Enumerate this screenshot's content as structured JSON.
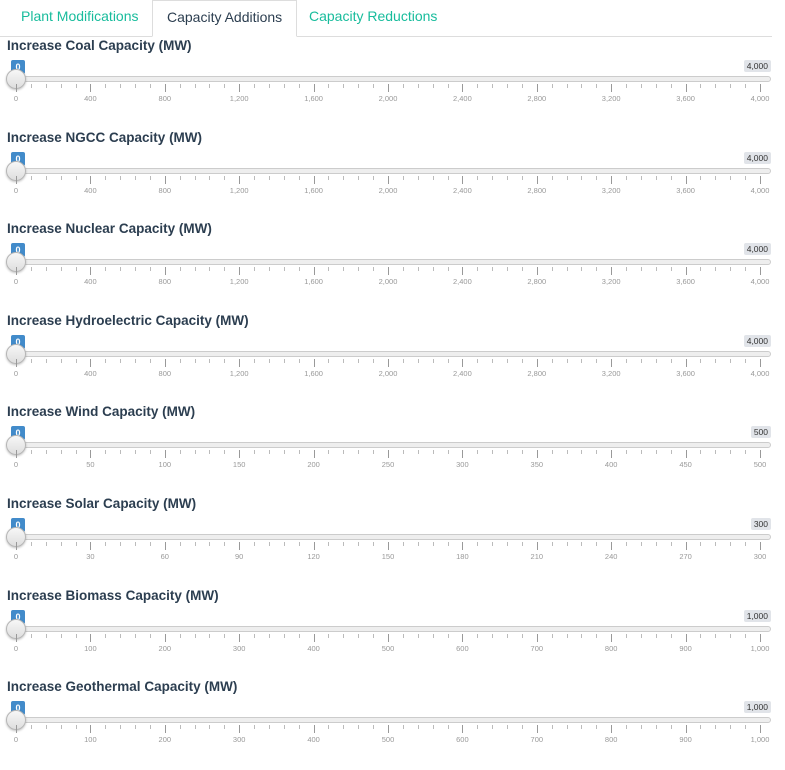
{
  "tabs": [
    {
      "label": "Plant Modifications",
      "active": false
    },
    {
      "label": "Capacity Additions",
      "active": true
    },
    {
      "label": "Capacity Reductions",
      "active": false
    }
  ],
  "colors": {
    "tab_link": "#18bc9c",
    "tab_active": "#2c3e50",
    "min_badge": "#428bca",
    "max_badge": "#e1e4e9"
  },
  "sliders": [
    {
      "label": "Increase Coal Capacity (MW)",
      "value": "0",
      "max_display": "4,000",
      "min": 0,
      "max": 4000,
      "ticks": [
        "0",
        "400",
        "800",
        "1,200",
        "1,600",
        "2,000",
        "2,400",
        "2,800",
        "3,200",
        "3,600",
        "4,000"
      ]
    },
    {
      "label": "Increase NGCC Capacity (MW)",
      "value": "0",
      "max_display": "4,000",
      "min": 0,
      "max": 4000,
      "ticks": [
        "0",
        "400",
        "800",
        "1,200",
        "1,600",
        "2,000",
        "2,400",
        "2,800",
        "3,200",
        "3,600",
        "4,000"
      ]
    },
    {
      "label": "Increase Nuclear Capacity (MW)",
      "value": "0",
      "max_display": "4,000",
      "min": 0,
      "max": 4000,
      "ticks": [
        "0",
        "400",
        "800",
        "1,200",
        "1,600",
        "2,000",
        "2,400",
        "2,800",
        "3,200",
        "3,600",
        "4,000"
      ]
    },
    {
      "label": "Increase Hydroelectric Capacity (MW)",
      "value": "0",
      "max_display": "4,000",
      "min": 0,
      "max": 4000,
      "ticks": [
        "0",
        "400",
        "800",
        "1,200",
        "1,600",
        "2,000",
        "2,400",
        "2,800",
        "3,200",
        "3,600",
        "4,000"
      ]
    },
    {
      "label": "Increase Wind Capacity (MW)",
      "value": "0",
      "max_display": "500",
      "min": 0,
      "max": 500,
      "ticks": [
        "0",
        "50",
        "100",
        "150",
        "200",
        "250",
        "300",
        "350",
        "400",
        "450",
        "500"
      ]
    },
    {
      "label": "Increase Solar Capacity (MW)",
      "value": "0",
      "max_display": "300",
      "min": 0,
      "max": 300,
      "ticks": [
        "0",
        "30",
        "60",
        "90",
        "120",
        "150",
        "180",
        "210",
        "240",
        "270",
        "300"
      ]
    },
    {
      "label": "Increase Biomass Capacity (MW)",
      "value": "0",
      "max_display": "1,000",
      "min": 0,
      "max": 1000,
      "ticks": [
        "0",
        "100",
        "200",
        "300",
        "400",
        "500",
        "600",
        "700",
        "800",
        "900",
        "1,000"
      ]
    },
    {
      "label": "Increase Geothermal Capacity (MW)",
      "value": "0",
      "max_display": "1,000",
      "min": 0,
      "max": 1000,
      "ticks": [
        "0",
        "100",
        "200",
        "300",
        "400",
        "500",
        "600",
        "700",
        "800",
        "900",
        "1,000"
      ]
    }
  ]
}
